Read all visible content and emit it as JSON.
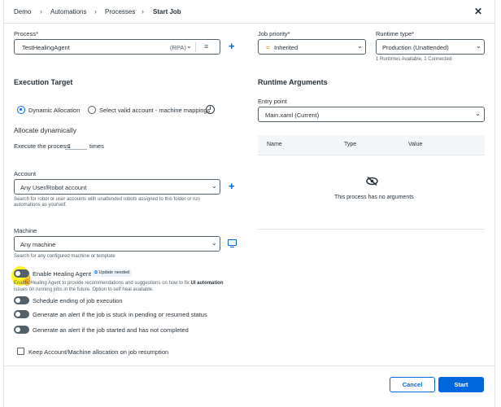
{
  "breadcrumb": {
    "items": [
      "Demo",
      "Automations",
      "Processes",
      "Start Job"
    ]
  },
  "process": {
    "label": "Process*",
    "value": "TestHealingAgent",
    "tag": "(RPA)"
  },
  "job_priority": {
    "label": "Job priority*",
    "value": "Inherited",
    "icon": "equals-icon"
  },
  "runtime_type": {
    "label": "Runtime type*",
    "value": "Production (Unattended)",
    "hint": "1 Runtimes Available, 1 Connected"
  },
  "execution_target": {
    "title": "Execution Target",
    "radio_dynamic": "Dynamic Allocation",
    "radio_mappings": "Select valid account - machine mappings",
    "allocate_title": "Allocate dynamically",
    "execute_prefix": "Execute the process",
    "execute_value": "1",
    "execute_suffix": "times"
  },
  "account": {
    "label": "Account",
    "value": "Any User/Robot account",
    "hint_line1": "Search for robot or user accounts with unattended robots assigned to this folder or run",
    "hint_line2": "automations as yourself."
  },
  "machine": {
    "label": "Machine",
    "value": "Any machine",
    "hint": "Search for any configured machine or template"
  },
  "healing": {
    "label": "Enable Healing Agent",
    "badge": "Update needed",
    "desc_prefix": "Enable Healing Agent to provide recommendations and suggestions on how to fix ",
    "desc_bold": "UI automation",
    "desc_line2": "issues on running jobs in the future. Option to self heal available."
  },
  "toggles": [
    "Schedule ending of job execution",
    "Generate an alert if the job is stuck in pending or resumed status",
    "Generate an alert if the job started and has not completed"
  ],
  "keep_allocation": "Keep Account/Machine allocation on job resumption",
  "runtime_args": {
    "title": "Runtime Arguments",
    "entry_label": "Entry point",
    "entry_value": "Main.xaml (Current)",
    "columns": [
      "Name",
      "Type",
      "Value"
    ],
    "empty_text": "This process has no arguments"
  },
  "footer": {
    "cancel": "Cancel",
    "start": "Start"
  },
  "colors": {
    "accent": "#0067df",
    "priority_icon": "#fa8c16",
    "highlight": "#fff000"
  }
}
